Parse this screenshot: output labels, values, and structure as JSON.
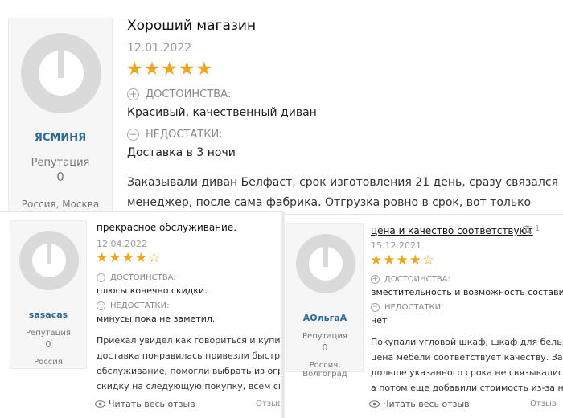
{
  "review1": {
    "user": {
      "name": "ЯСМИНЯ",
      "rep_label": "Репутация",
      "rep_value": "0",
      "location": "Россия, Москва"
    },
    "title": "Хороший магазин",
    "date": "12.01.2022",
    "rating": 5,
    "pros_label": "ДОСТОИНСТВА:",
    "pros": "Красивый, качественный диван",
    "cons_label": "НЕДОСТАТКИ:",
    "cons": "Доставка в 3 ночи",
    "body": [
      "Заказывали диван Белфаст, срок изготовления 21 день, сразу связался",
      "менеджер, после сама фабрика. Отгрузка ровно в срок, вот только"
    ]
  },
  "review2": {
    "user": {
      "name": "sasacas",
      "rep_label": "Репутация",
      "rep_value": "0",
      "location": "Россия"
    },
    "title": "прекрасное обслуживание.",
    "date": "12.04.2022",
    "rating": 4,
    "pros_label": "ДОСТОИНСТВА:",
    "pros": "плюсы конечно скидки.",
    "cons_label": "НЕДОСТАТКИ:",
    "cons": "минусы пока не заметил.",
    "body": [
      "Приехал увидел как говориться и купил хоро",
      "доставка понравилась привезли быстро, собр",
      "обслуживание, помогли выбрать из огромног",
      "скидку на следующую покупку, всем спасибо"
    ],
    "read_more": "Читать весь отзыв",
    "footer_extra": "Отзыв"
  },
  "review3": {
    "user": {
      "name": "АОльгаА",
      "rep_label": "Репутация",
      "rep_value": "0",
      "location": "Россия, Волгоград"
    },
    "title": "цена и качество соответствуют",
    "photo_count": "1",
    "date": "15.12.2021",
    "rating": 4,
    "pros_label": "ДОСТОИНСТВА:",
    "pros": "вместительность и возможность составить свой",
    "cons_label": "НЕДОСТАТКИ:",
    "cons": "нет",
    "body": [
      "Покупали угловой шкаф, шкаф для белья и тор",
      "цена мебели соответствует качеству. Заказыва",
      "дольше указанного срока не связывались для н",
      "а потом еще добавили стоимость из-за невозмо"
    ],
    "read_more": "Читать весь отзыв",
    "footer_extra": "Отзыв"
  },
  "icons": {
    "plus": "+",
    "minus": "−",
    "eye": "eye-icon",
    "camera": "camera-icon"
  },
  "colors": {
    "star": "#f0a51e",
    "username": "#2d6a8f"
  }
}
